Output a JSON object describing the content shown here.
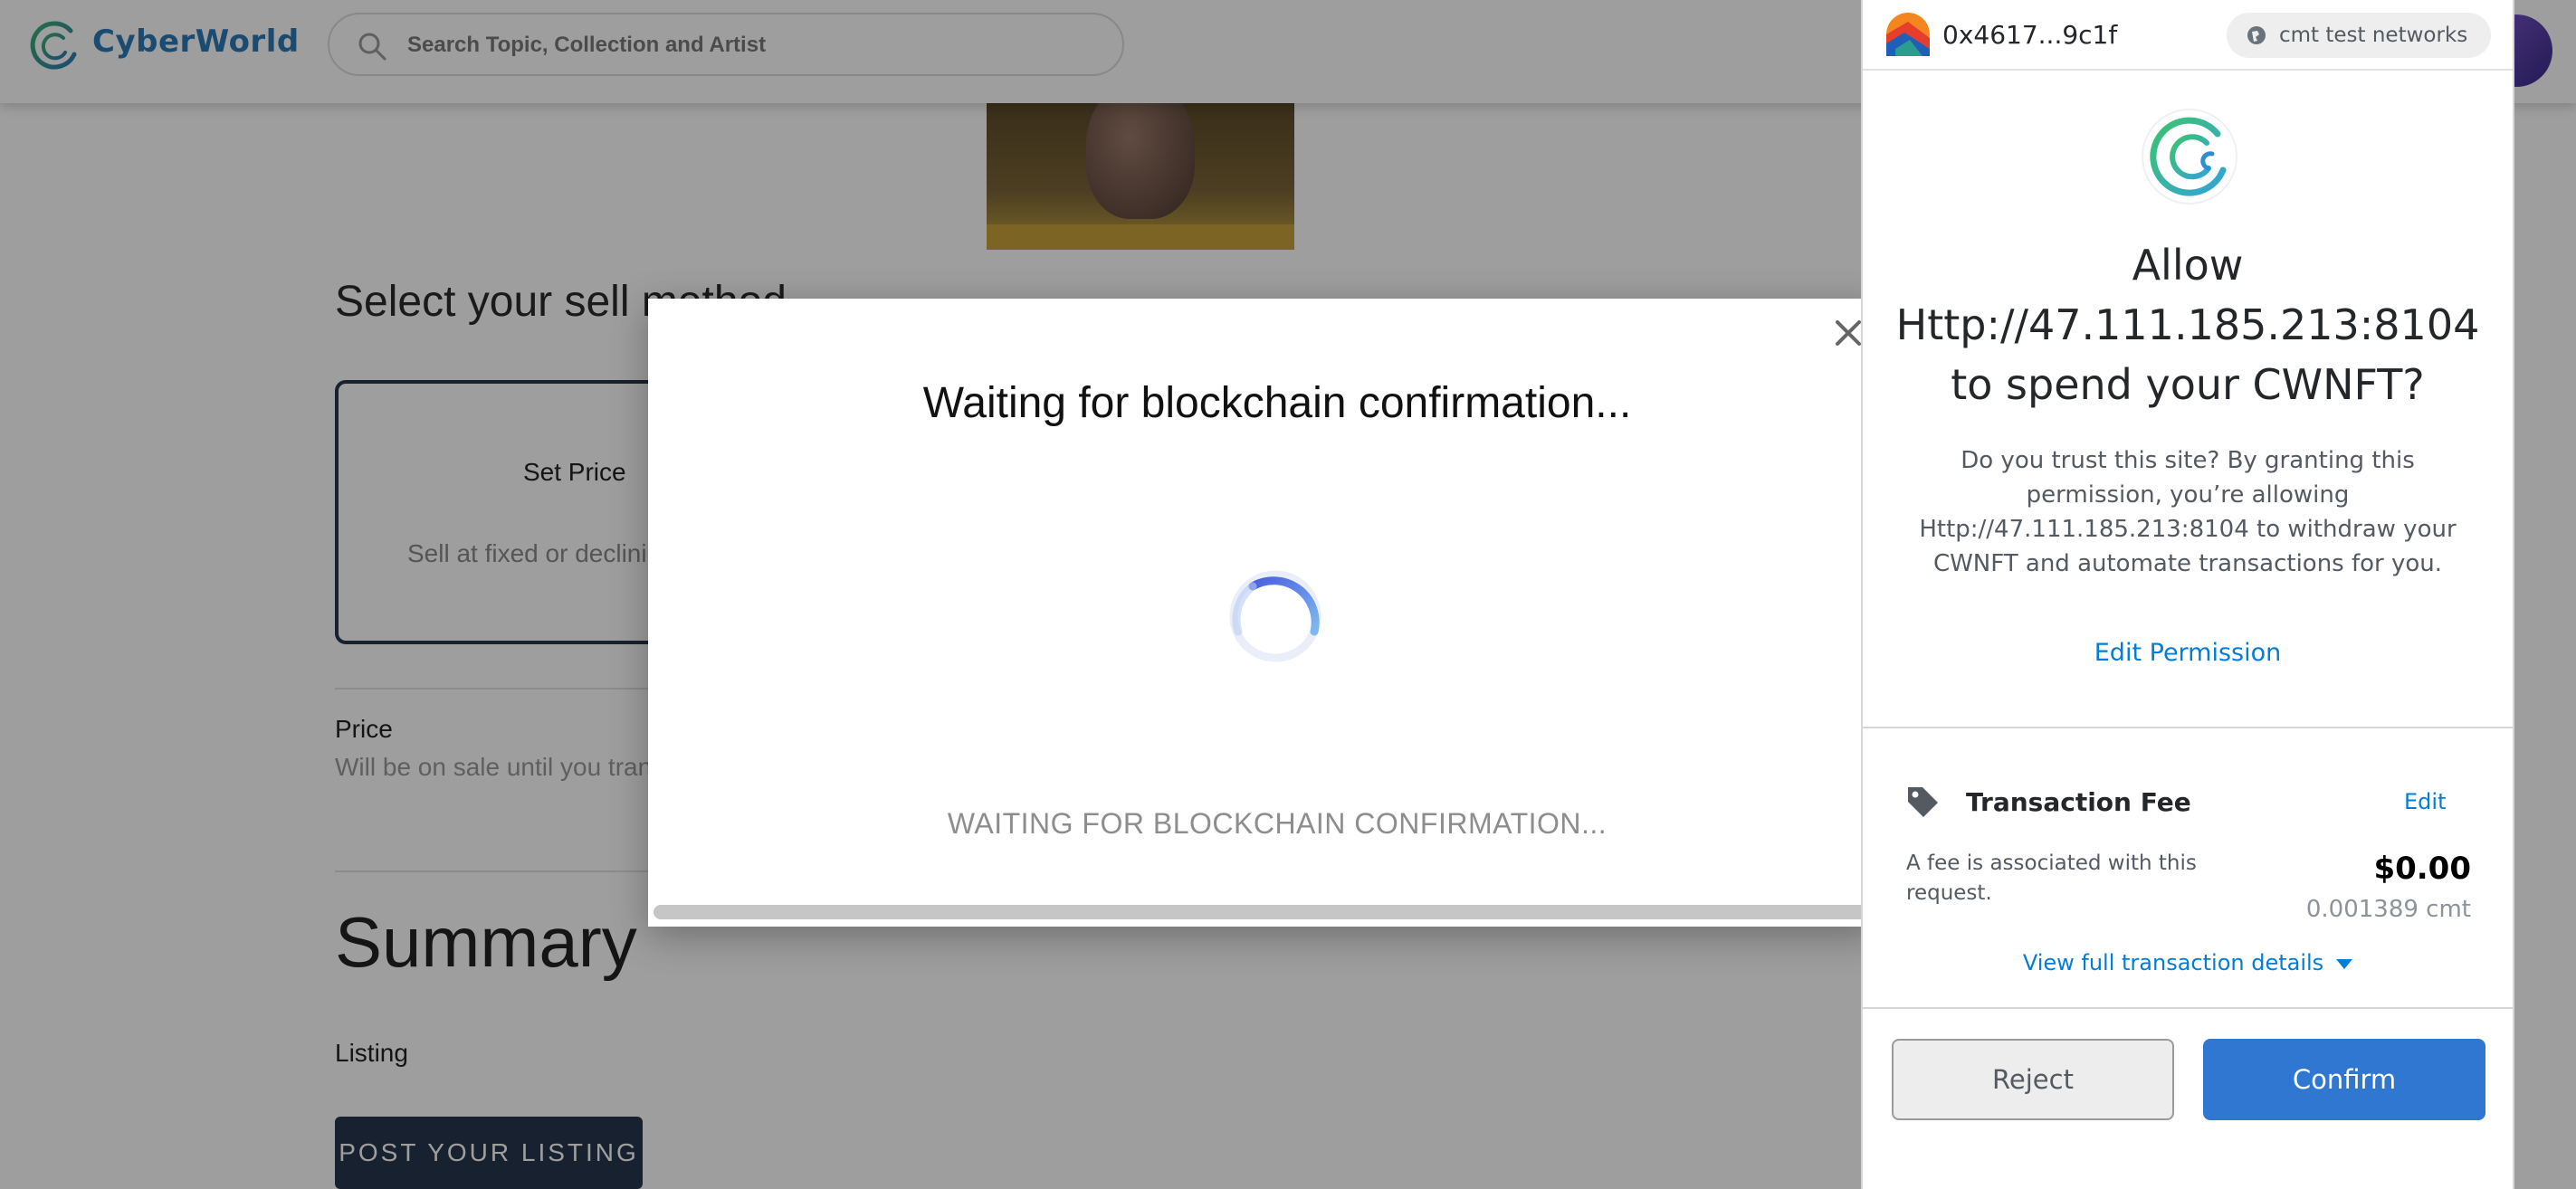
{
  "site": {
    "brand": "CyberWorld",
    "search_placeholder": "Search Topic, Collection and Artist"
  },
  "sell": {
    "title": "Select your sell method",
    "method_title": "Set Price",
    "method_sub": "Sell at fixed or declining price",
    "price_label": "Price",
    "price_sub": "Will be on sale until you transfer this item or cancel it.",
    "summary_title": "Summary",
    "listing_label": "Listing",
    "post_button": "POST YOUR LISTING"
  },
  "modal": {
    "title": "Waiting for blockchain confirmation...",
    "status": "WAITING FOR BLOCKCHAIN CONFIRMATION..."
  },
  "wallet": {
    "address": "0x4617...9c1f",
    "network": "cmt test networks",
    "title": "Allow Http://47.111.185.213:8104 to spend your CWNFT?",
    "description": "Do you trust this site? By granting this permission, you’re allowing Http://47.111.185.213:8104 to withdraw your CWNFT and automate transactions for you.",
    "edit_permission": "Edit Permission",
    "fee_label": "Transaction Fee",
    "fee_edit": "Edit",
    "fee_desc": "A fee is associated with this request.",
    "fee_usd": "$0.00",
    "fee_cmt": "0.001389 cmt",
    "view_details": "View full transaction details",
    "reject": "Reject",
    "confirm": "Confirm"
  },
  "colors": {
    "brand": "#2e7ab8",
    "accent_navy": "#27364d",
    "wallet_link": "#037dd6",
    "confirm_blue": "#2f77d0"
  },
  "icons": {
    "logo": "cyberworld-logo-icon",
    "search": "search-icon",
    "close": "close-icon",
    "spinner": "loading-spinner-icon",
    "account": "account-avatar-icon",
    "network": "network-globe-icon",
    "tag": "price-tag-icon",
    "caret": "chevron-down-icon"
  }
}
